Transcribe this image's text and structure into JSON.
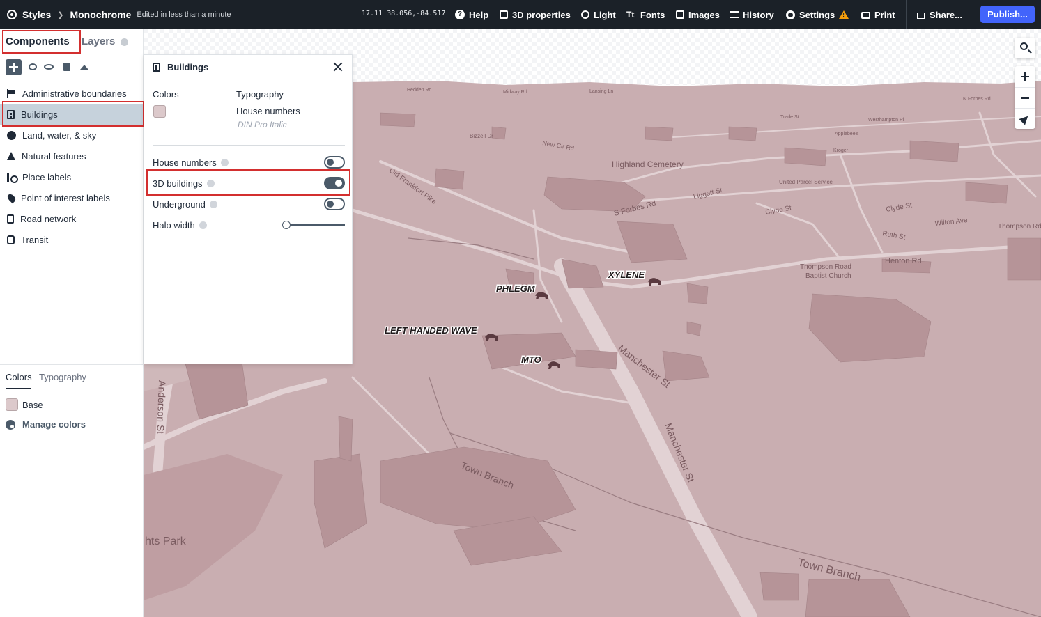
{
  "header": {
    "crumb_root": "Styles",
    "style_name": "Monochrome",
    "edited": "Edited in less than a minute",
    "coords": "17.11 38.056,-84.517",
    "buttons": {
      "help": "Help",
      "props3d": "3D properties",
      "light": "Light",
      "fonts": "Fonts",
      "images": "Images",
      "history": "History",
      "settings": "Settings",
      "print": "Print",
      "share": "Share...",
      "publish": "Publish..."
    }
  },
  "sidebar": {
    "tab_components": "Components",
    "tab_layers": "Layers",
    "items": [
      {
        "label": "Administrative boundaries",
        "icon": "flag-icon"
      },
      {
        "label": "Buildings",
        "icon": "building-icon",
        "selected": true
      },
      {
        "label": "Land, water, & sky",
        "icon": "globe-icon"
      },
      {
        "label": "Natural features",
        "icon": "tree-icon"
      },
      {
        "label": "Place labels",
        "icon": "place-icon"
      },
      {
        "label": "Point of interest labels",
        "icon": "pin-icon"
      },
      {
        "label": "Road network",
        "icon": "road-icon"
      },
      {
        "label": "Transit",
        "icon": "transit-icon"
      }
    ],
    "lower": {
      "tab_colors": "Colors",
      "tab_typography": "Typography",
      "base_label": "Base",
      "manage_colors": "Manage colors"
    }
  },
  "popover": {
    "title": "Buildings",
    "colors_label": "Colors",
    "typography_label": "Typography",
    "house_numbers_sub": "House numbers",
    "font_name": "DIN Pro Italic",
    "rows": {
      "house_numbers": "House numbers",
      "buildings_3d": "3D buildings",
      "underground": "Underground",
      "halo_width": "Halo width"
    },
    "toggles": {
      "house_numbers": false,
      "buildings_3d": true,
      "underground": false
    },
    "swatch_color": "#dcc9cb"
  },
  "map": {
    "background_color": "#c9aeb1",
    "labels": {
      "phlegm": "PHLEGM",
      "xylene": "XYLENE",
      "left_handed_wave": "LEFT HANDED WAVE",
      "mto": "MTO",
      "highland_cemetery": "Highland Cemetery",
      "s_forbes_rd": "S Forbes Rd",
      "manchester_st_1": "Manchester St",
      "manchester_st_2": "Manchester St",
      "town_branch_1": "Town Branch",
      "town_branch_2": "Town Branch",
      "anderson_st": "Anderson St",
      "hts_park": "hts Park",
      "thompson_church_1": "Thompson Road",
      "thompson_church_2": "Baptist Church",
      "henton_rd": "Henton Rd",
      "wilton_ave": "Wilton Ave",
      "clyde_st_1": "Clyde St",
      "clyde_st_2": "Clyde St",
      "liggett_st": "Liggett St",
      "ruth_st": "Ruth St",
      "thompson_rd": "Thompson Rd",
      "ups": "United Parcel Service",
      "new_cir_rd": "New Cir Rd",
      "old_frankfort_pike": "Old Frankfort Pike",
      "bizzell_dr": "Bizzell Dr",
      "midway_rd": "Midway Rd",
      "hedden_rd": "Hedden Rd",
      "lansing_ln": "Lansing Ln",
      "trade_st": "Trade St",
      "westhampton_pl": "Westhampton Pl",
      "kroger": "Kroger",
      "applebees": "Applebee's",
      "n_forbes_rd": "N Forbes Rd"
    }
  }
}
